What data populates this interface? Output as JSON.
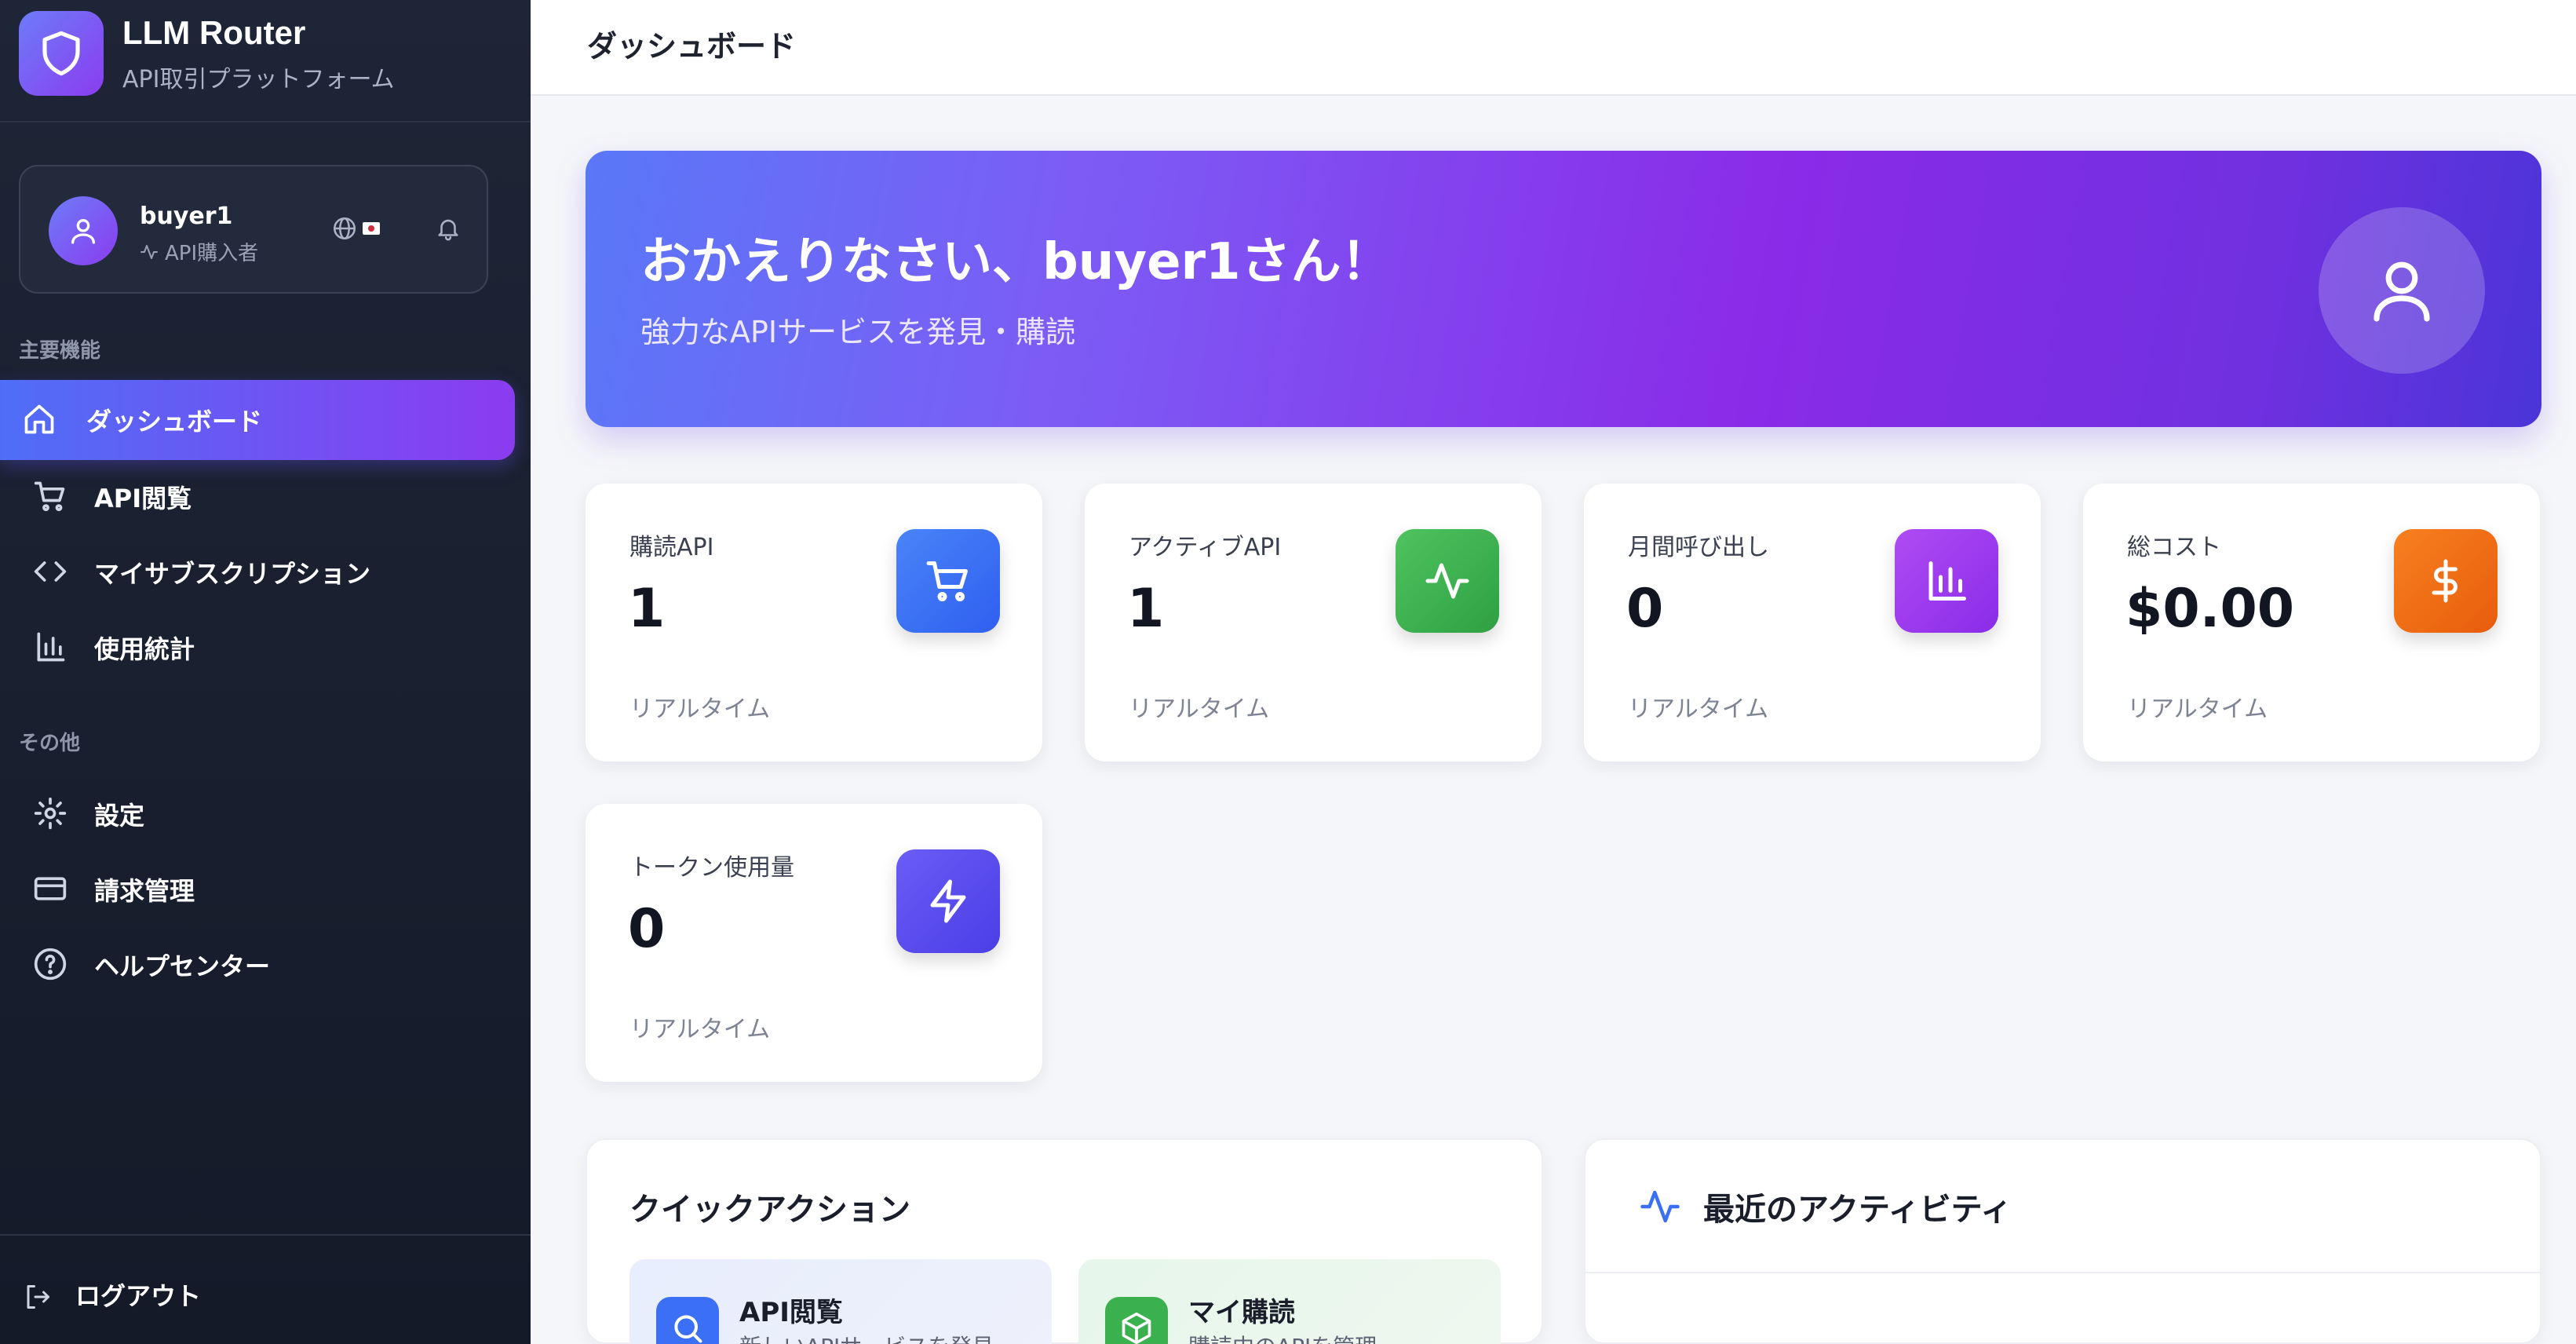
{
  "sidebar": {
    "brand_title": "LLM Router",
    "brand_subtitle": "API取引プラットフォーム",
    "user": {
      "name": "buyer1",
      "role": "API購入者"
    },
    "section_main": "主要機能",
    "section_other": "その他",
    "items_main": [
      {
        "label": "ダッシュボード",
        "icon": "home-icon",
        "active": true
      },
      {
        "label": "API閲覧",
        "icon": "cart-icon"
      },
      {
        "label": "マイサブスクリプション",
        "icon": "code-icon"
      },
      {
        "label": "使用統計",
        "icon": "bar-chart-icon"
      }
    ],
    "items_other": [
      {
        "label": "設定",
        "icon": "gear-icon"
      },
      {
        "label": "請求管理",
        "icon": "credit-card-icon"
      },
      {
        "label": "ヘルプセンター",
        "icon": "help-icon"
      }
    ],
    "logout_label": "ログアウト"
  },
  "header": {
    "title": "ダッシュボード"
  },
  "hero": {
    "title": "おかえりなさい、buyer1さん！",
    "subtitle": "強力なAPIサービスを発見・購読"
  },
  "stats": [
    {
      "label": "購読API",
      "value": "1",
      "foot": "リアルタイム",
      "icon": "cart-icon",
      "color": "#3b6ff5"
    },
    {
      "label": "アクティブAPI",
      "value": "1",
      "foot": "リアルタイム",
      "icon": "activity-icon",
      "color": "#3bb04f"
    },
    {
      "label": "月間呼び出し",
      "value": "0",
      "foot": "リアルタイム",
      "icon": "bar-chart-icon",
      "color": "#9b3cf0"
    },
    {
      "label": "総コスト",
      "value": "$0.00",
      "foot": "リアルタイム",
      "icon": "dollar-icon",
      "color": "#f06a12"
    },
    {
      "label": "トークン使用量",
      "value": "0",
      "foot": "リアルタイム",
      "icon": "lightning-icon",
      "color": "#5a4cf0"
    }
  ],
  "quick_actions": {
    "title": "クイックアクション",
    "items": [
      {
        "title": "API閲覧",
        "desc": "新しいAPIサービスを発見",
        "icon": "search-icon"
      },
      {
        "title": "マイ購読",
        "desc": "購読中のAPIを管理",
        "icon": "box-icon"
      }
    ]
  },
  "recent_activity": {
    "title": "最近のアクティビティ"
  }
}
